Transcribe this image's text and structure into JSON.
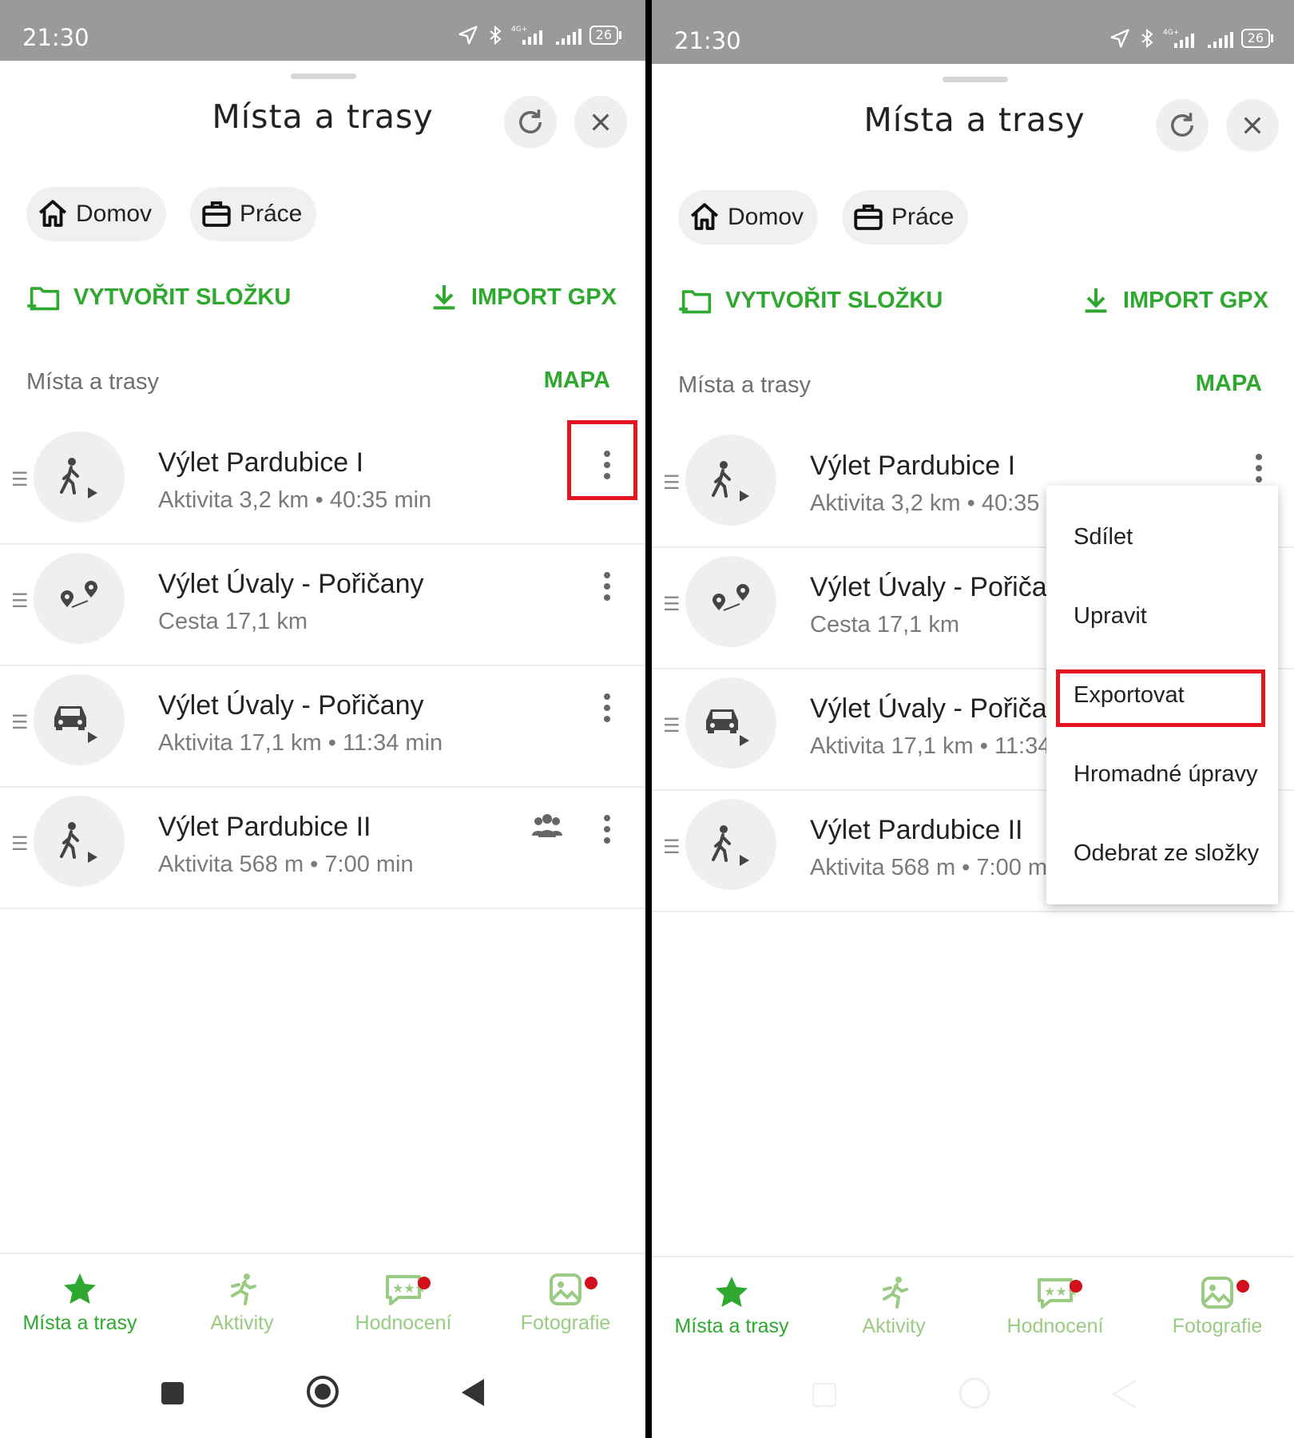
{
  "status_bar": {
    "time": "21:30",
    "battery": "26"
  },
  "header": {
    "title": "Místa a trasy"
  },
  "chips": {
    "home": "Domov",
    "work": "Práce"
  },
  "actions": {
    "create_folder": "VYTVOŘIT SLOŽKU",
    "import_gpx": "IMPORT GPX"
  },
  "section": {
    "label": "Místa a trasy",
    "map_link": "MAPA"
  },
  "items": [
    {
      "title": "Výlet Pardubice I",
      "subtitle": "Aktivita 3,2 km • 40:35 min",
      "icon": "walking-icon"
    },
    {
      "title": "Výlet Úvaly - Pořičany",
      "subtitle": "Cesta 17,1 km",
      "icon": "route-pins-icon"
    },
    {
      "title": "Výlet Úvaly - Pořičany",
      "subtitle": "Aktivita 17,1 km • 11:34 min",
      "icon": "car-icon"
    },
    {
      "title": "Výlet Pardubice II",
      "subtitle": "Aktivita 568 m • 7:00 min",
      "icon": "walking-icon"
    }
  ],
  "context_menu": {
    "items": [
      "Sdílet",
      "Upravit",
      "Exportovat",
      "Hromadné úpravy",
      "Odebrat ze složky"
    ],
    "highlighted": "Exportovat"
  },
  "bottom_nav": {
    "items": [
      "Místa a trasy",
      "Aktivity",
      "Hodnocení",
      "Fotografie"
    ],
    "active": "Místa a trasy"
  },
  "colors": {
    "accent": "#2ea82e",
    "highlight": "#e4151e",
    "badge": "#d2101c",
    "statusbar": "#9a9a9a"
  }
}
